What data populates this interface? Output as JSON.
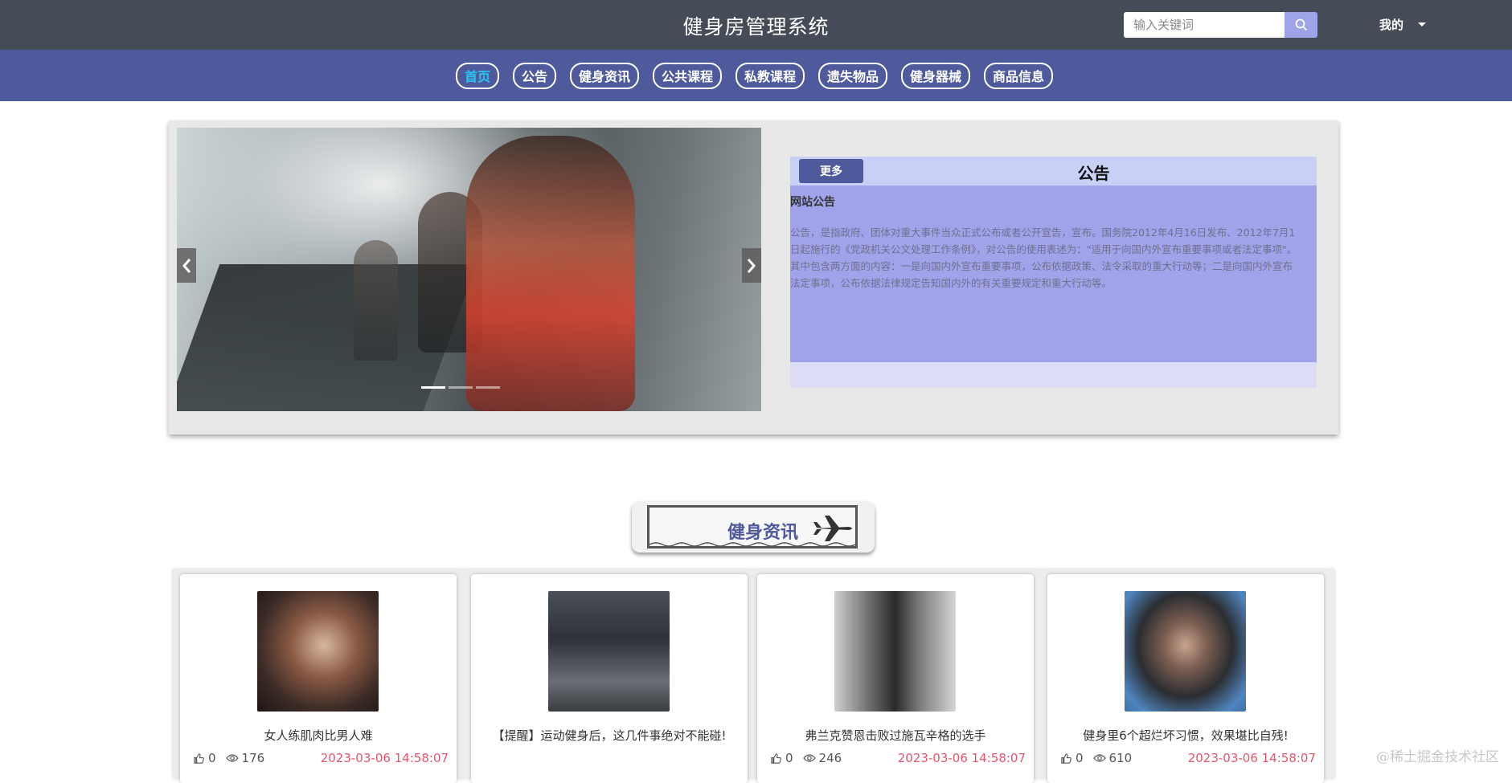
{
  "header": {
    "site_title": "健身房管理系统",
    "search_placeholder": "输入关键词",
    "user_menu_label": "我的"
  },
  "nav": {
    "items": [
      {
        "label": "首页",
        "active": true
      },
      {
        "label": "公告",
        "active": false
      },
      {
        "label": "健身资讯",
        "active": false
      },
      {
        "label": "公共课程",
        "active": false
      },
      {
        "label": "私教课程",
        "active": false
      },
      {
        "label": "遗失物品",
        "active": false
      },
      {
        "label": "健身器械",
        "active": false
      },
      {
        "label": "商品信息",
        "active": false
      }
    ]
  },
  "carousel": {
    "slide_count": 3,
    "active_index": 0
  },
  "notice": {
    "more_label": "更多",
    "title": "公告",
    "subtitle": "网站公告",
    "text": "公告，是指政府、团体对重大事件当众正式公布或者公开宣告，宣布。国务院2012年4月16日发布、2012年7月1日起施行的《党政机关公文处理工作条例》，对公告的使用表述为：\"适用于向国内外宣布重要事项或者法定事项\"。其中包含两方面的内容：一是向国内外宣布重要事项，公布依据政策、法令采取的重大行动等；二是向国内外宣布法定事项，公布依据法律规定告知国内外的有关重要规定和重大行动等。"
  },
  "news_section": {
    "title": "健身资讯",
    "cards": [
      {
        "title": "女人练肌肉比男人难",
        "likes": "0",
        "views": "176",
        "date": "2023-03-06 14:58:07"
      },
      {
        "title": "【提醒】运动健身后，这几件事绝对不能碰!",
        "likes": "",
        "views": "",
        "date": ""
      },
      {
        "title": "弗兰克赞恩击败过施瓦辛格的选手",
        "likes": "0",
        "views": "246",
        "date": "2023-03-06 14:58:07"
      },
      {
        "title": "健身里6个超烂坏习惯，效果堪比自残!",
        "likes": "0",
        "views": "610",
        "date": "2023-03-06 14:58:07"
      }
    ]
  },
  "watermark": "@稀土掘金技术社区",
  "colors": {
    "topbar": "#464c57",
    "navbar": "#4f5a9d",
    "nav_active": "#27c8f2",
    "notice_body": "#a0a3ea",
    "date_red": "#e2566b"
  }
}
